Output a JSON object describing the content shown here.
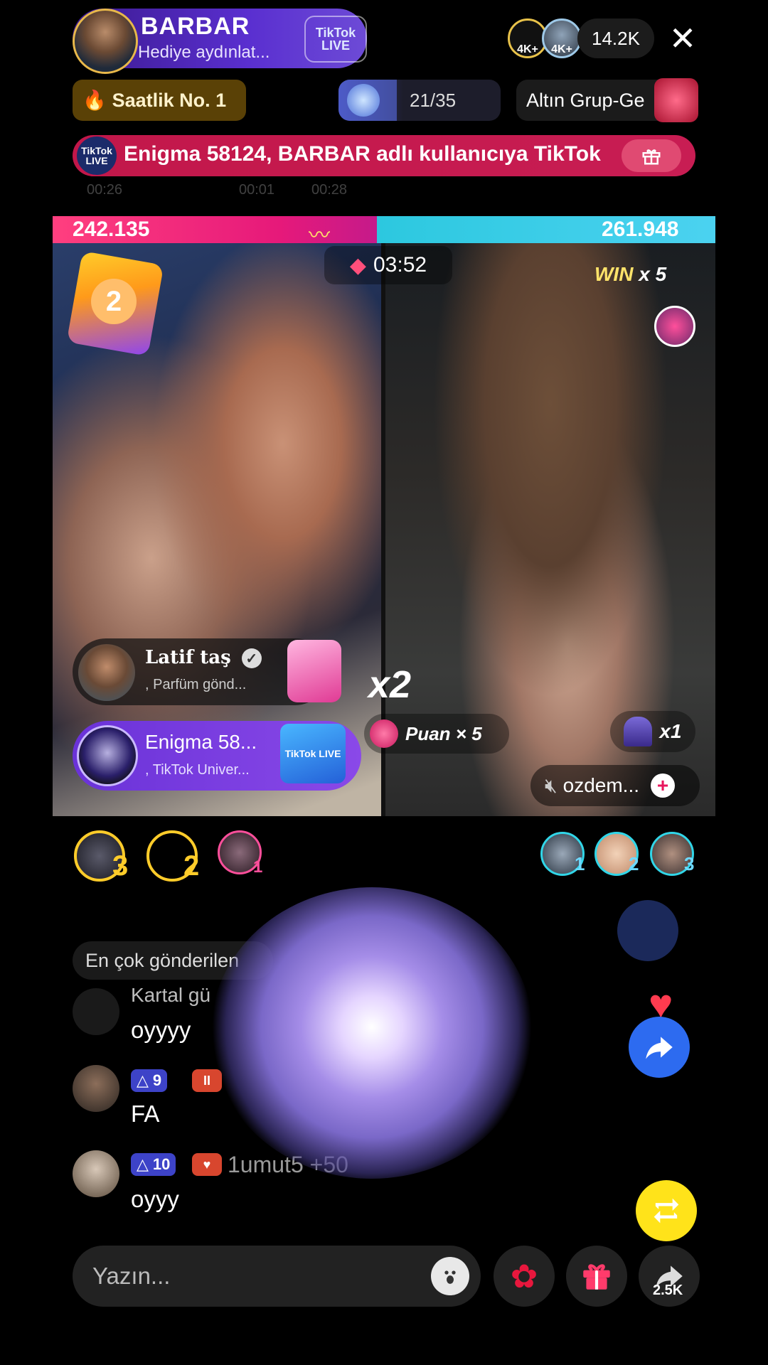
{
  "header": {
    "host_name": "BARBAR",
    "host_subtitle": "Hediye aydınlat...",
    "live_badge": "TikTok LIVE",
    "viewers": [
      {
        "label": "4K+",
        "color": "#e8c24a"
      },
      {
        "label": "4K+",
        "color": "#9ec9e8"
      }
    ],
    "viewer_count": "14.2K",
    "close_icon": "close-icon"
  },
  "row2": {
    "saatlik_label": "Saatlik No. 1",
    "progress_text": "21/35",
    "progress_fraction": 0.6,
    "altin_label": "Altın Grup-Ge"
  },
  "banner": {
    "icon_text": "TikTok LIVE",
    "text": "Enigma 58124, BARBAR adlı kullanıcıya TikTok"
  },
  "faded_timers": [
    "00:26",
    "00:01",
    "00:28"
  ],
  "battle": {
    "score_left": "242.135",
    "score_right": "261.948",
    "left_fraction": 0.48,
    "timer": "03:52",
    "win_label": "WIN",
    "win_multiplier": "x 5",
    "boost_count": "2",
    "gift_row1": {
      "name": "Latif taş",
      "sub": ", Parfüm  gönd..."
    },
    "gift_row2": {
      "name": "Enigma 58...",
      "sub": ", TikTok Univer...",
      "icon_text": "TikTok LIVE"
    },
    "x2_label": "x2",
    "puan_label": "Puan × 5",
    "x1_label": "x1",
    "ozdem_label": "ozdem..."
  },
  "ranks_left": [
    "3",
    "2",
    "1"
  ],
  "ranks_right": [
    "1",
    "2",
    "3"
  ],
  "chat": {
    "top_senders_label": "En çok gönderilen",
    "messages": [
      {
        "name": "Kartal gü",
        "text": "oyyyy"
      },
      {
        "level": "9",
        "name": "",
        "text": "FA"
      },
      {
        "level": "10",
        "name": "1umut5 +50",
        "text": "oyyy"
      }
    ]
  },
  "bottom": {
    "input_placeholder": "Yazın...",
    "share_count": "2.5K"
  },
  "colors": {
    "accent_pink": "#e6197a",
    "accent_cyan": "#2cc8df",
    "share_blue": "#2d6bf0",
    "repost_yellow": "#ffe31a"
  }
}
